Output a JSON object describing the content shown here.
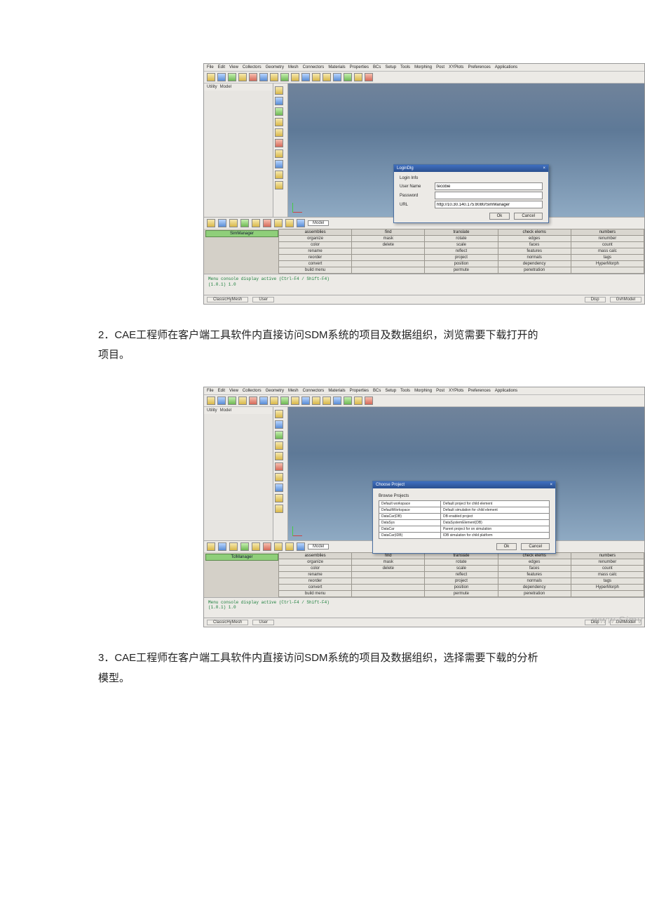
{
  "captions": {
    "p2": "2．CAE工程师在客户端工具软件内直接访问SDM系统的项目及数据组织，浏览需要下载打开的项目。",
    "p3": "3．CAE工程师在客户端工具软件内直接访问SDM系统的项目及数据组织，选择需要下载的分析模型。"
  },
  "app": {
    "menus": [
      "File",
      "Edit",
      "View",
      "Collectors",
      "Geometry",
      "Mesh",
      "Connectors",
      "Materials",
      "Properties",
      "BCs",
      "Setup",
      "Tools",
      "Morphing",
      "Post",
      "XYPlots",
      "Preferences",
      "Applications"
    ],
    "left_tabs": [
      "Utility",
      "Model"
    ],
    "status": {
      "left": "ClassicHyMesh",
      "mid": "User",
      "right": "GvhModel"
    },
    "model_chip": "Model",
    "console_line1": "Menu console display active (Ctrl-F4 / Shift-F4)",
    "console_line2": "(1.0.1) 1.0",
    "green_tab_1": "SimManager",
    "green_tab_2": "TclManager",
    "grid": {
      "headers": [
        "assemblies",
        "find",
        "translate",
        "check elems",
        "numbers"
      ],
      "rows": [
        [
          "organize",
          "mask",
          "rotate",
          "edges",
          "renumber"
        ],
        [
          "color",
          "delete",
          "scale",
          "faces",
          "count"
        ],
        [
          "rename",
          "",
          "reflect",
          "features",
          "mass calc"
        ],
        [
          "reorder",
          "",
          "project",
          "normals",
          "tags"
        ],
        [
          "convert",
          "",
          "position",
          "dependency",
          "HyperMorph"
        ],
        [
          "build menu",
          "",
          "permute",
          "penetration",
          ""
        ]
      ]
    }
  },
  "dialog_login": {
    "title": "LoginDlg",
    "section": "Login Info",
    "labels": {
      "user": "User Name",
      "pass": "Password",
      "url": "URL"
    },
    "values": {
      "user": "tecobie",
      "pass": "",
      "url": "http://10.30.140.175:8080/SimManager"
    },
    "ok": "Ok",
    "cancel": "Cancel"
  },
  "dialog_choose": {
    "title": "Choose Project",
    "section": "Browse Projects",
    "ok": "Ok",
    "cancel": "Cancel",
    "rows": [
      [
        "Default workspace",
        "Default project for child element"
      ],
      [
        "DefaultWorkspace",
        "Default simulation for child element"
      ],
      [
        "DataCar(DB)",
        "DB enabled project"
      ],
      [
        "DataSys",
        "DataSystemElement(DB)"
      ],
      [
        "DataCar",
        "Parent project for on simulation"
      ],
      [
        "DataCar(IDB)",
        "IDB simulation for child platform"
      ]
    ]
  },
  "watermark": "www.Simv"
}
